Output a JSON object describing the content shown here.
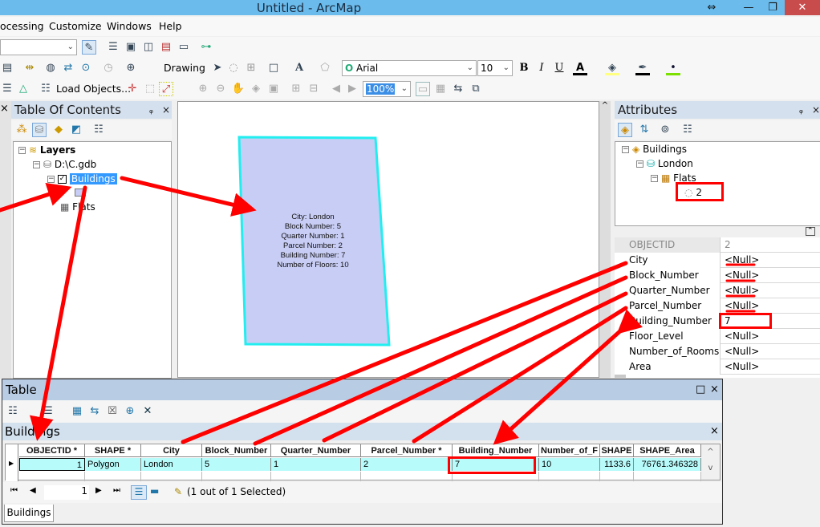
{
  "window": {
    "title": "Untitled - ArcMap",
    "controls": {
      "resize": "⇔",
      "minimize": "—",
      "restore": "❐",
      "close": "✕"
    }
  },
  "menubar": {
    "items": [
      "ocessing",
      "Customize",
      "Windows",
      "Help"
    ]
  },
  "toolbar": {
    "drawing_label": "Drawing",
    "load_objects_label": "Load Objects...",
    "font_name": "Arial",
    "font_size": "10",
    "bold": "B",
    "italic": "I",
    "underline": "U",
    "font_color": "A",
    "zoom_level": "100%"
  },
  "toc": {
    "title": "Table Of Contents",
    "tree": {
      "root": "Layers",
      "gdb": "D:\\C.gdb",
      "layer": "Buildings",
      "table": "Flats"
    }
  },
  "map": {
    "label_lines": [
      "City: London",
      "Block Number: 5",
      "Quarter Number: 1",
      "Parcel Number: 2",
      "Building Number: 7",
      "Number of Floors: 10"
    ],
    "polygon_fill": "#c8cdf5",
    "polygon_outline": "#22eef0"
  },
  "attributes": {
    "title": "Attributes",
    "tree": {
      "layer": "Buildings",
      "feature": "London",
      "relate": "Flats",
      "record": "2"
    },
    "grid": [
      {
        "key": "OBJECTID",
        "value": "2"
      },
      {
        "key": "City",
        "value": "<Null>"
      },
      {
        "key": "Block_Number",
        "value": "<Null>"
      },
      {
        "key": "Quarter_Number",
        "value": "<Null>"
      },
      {
        "key": "Parcel_Number",
        "value": "<Null>"
      },
      {
        "key": "Building_Number",
        "value": "7"
      },
      {
        "key": "Floor_Level",
        "value": "<Null>"
      },
      {
        "key": "Number_of_Rooms",
        "value": "<Null>"
      },
      {
        "key": "Area",
        "value": "<Null>"
      }
    ]
  },
  "table": {
    "title": "Table",
    "layer_name": "Buildings",
    "columns": [
      "OBJECTID *",
      "SHAPE *",
      "City",
      "Block_Number",
      "Quarter_Number",
      "Parcel_Number *",
      "Building_Number",
      "Number_of_F",
      "SHAPE",
      "SHAPE_Area"
    ],
    "rows": [
      [
        "1",
        "Polygon",
        "London",
        "5",
        "1",
        "2",
        "7",
        "10",
        "1133.6",
        "76761.346328"
      ]
    ],
    "current_record": "1",
    "selection_status": "(1 out of 1 Selected)",
    "tab_label": "Buildings"
  },
  "annotation_color": "#ff0000"
}
